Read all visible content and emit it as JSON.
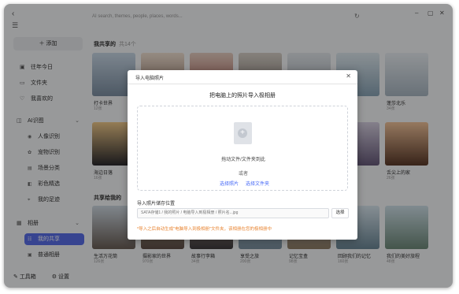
{
  "titlebar": {
    "back_icon": "chevron-left-icon",
    "menu_icon": "menu-icon",
    "search_placeholder": "AI search, themes, people, places, words...",
    "refresh_icon": "refresh-icon"
  },
  "sidebar": {
    "add_label": "添加",
    "items": [
      {
        "label": "往年今日",
        "icon": "calendar-icon"
      },
      {
        "label": "文件夹",
        "icon": "folder-icon"
      },
      {
        "label": "我喜欢的",
        "icon": "heart-icon"
      }
    ],
    "ai_group": "AI识图",
    "ai_items": [
      {
        "label": "人像识别",
        "icon": "face-icon"
      },
      {
        "label": "宠物识别",
        "icon": "paw-icon"
      },
      {
        "label": "场景分类",
        "icon": "scene-icon"
      },
      {
        "label": "彩色精选",
        "icon": "color-icon"
      },
      {
        "label": "我的足迹",
        "icon": "location-icon"
      }
    ],
    "album_group": "相册",
    "album_items": [
      {
        "label": "我的共享",
        "icon": "share-icon",
        "active": true
      },
      {
        "label": "普通相册",
        "icon": "album-icon",
        "active": false
      }
    ],
    "toolbox_label": "工具箱",
    "settings_label": "设置"
  },
  "main": {
    "section1_title": "我共享的",
    "section1_count": "共14个",
    "section2_title": "共享给我的",
    "row1_captions": [
      {
        "title": "打卡世界",
        "count": "12张"
      },
      {
        "title": "",
        "count": ""
      },
      {
        "title": "",
        "count": ""
      },
      {
        "title": "",
        "count": ""
      },
      {
        "title": "",
        "count": ""
      },
      {
        "title": "",
        "count": ""
      },
      {
        "title": "蓬莎北乐",
        "count": "34张"
      }
    ],
    "row2_captions": [
      {
        "title": "海边日落",
        "count": "16张"
      },
      {
        "title": "",
        "count": ""
      },
      {
        "title": "",
        "count": ""
      },
      {
        "title": "",
        "count": ""
      },
      {
        "title": "",
        "count": ""
      },
      {
        "title": "",
        "count": ""
      },
      {
        "title": "舌尖上的家",
        "count": "26张"
      }
    ],
    "row3_captions": [
      {
        "title": "生活万花筒",
        "count": "126张"
      },
      {
        "title": "摄影家的世界",
        "count": "970张"
      },
      {
        "title": "故事行李箱",
        "count": "34张"
      },
      {
        "title": "享受之旅",
        "count": "200张"
      },
      {
        "title": "记忆宝盒",
        "count": "98张"
      },
      {
        "title": "回顾我们的记忆",
        "count": "160张"
      },
      {
        "title": "我们的美好旅程",
        "count": "48张"
      }
    ]
  },
  "dialog": {
    "title": "导入电脑照片",
    "close_icon": "close-icon",
    "heading": "把电脑上的照片导入极相册",
    "drop_hint": "拖动文件/文件夹到此",
    "or_text": "或者",
    "pick_photo": "选择照片",
    "pick_folder": "选择文件夹",
    "location_label": "导入照片储存位置",
    "path_value": "SATA存储1 / 我的照片 / 电脑导入到极相册 / 照片名...jpg",
    "browse_label": "选择",
    "warning": "*导入之后自动生成\"电脑导入到极相册\"文件夹，该相册在您的极相册中"
  },
  "colors": {
    "accent": "#5a6ee8",
    "link": "#4a6cf7",
    "warning": "#e8832f"
  }
}
